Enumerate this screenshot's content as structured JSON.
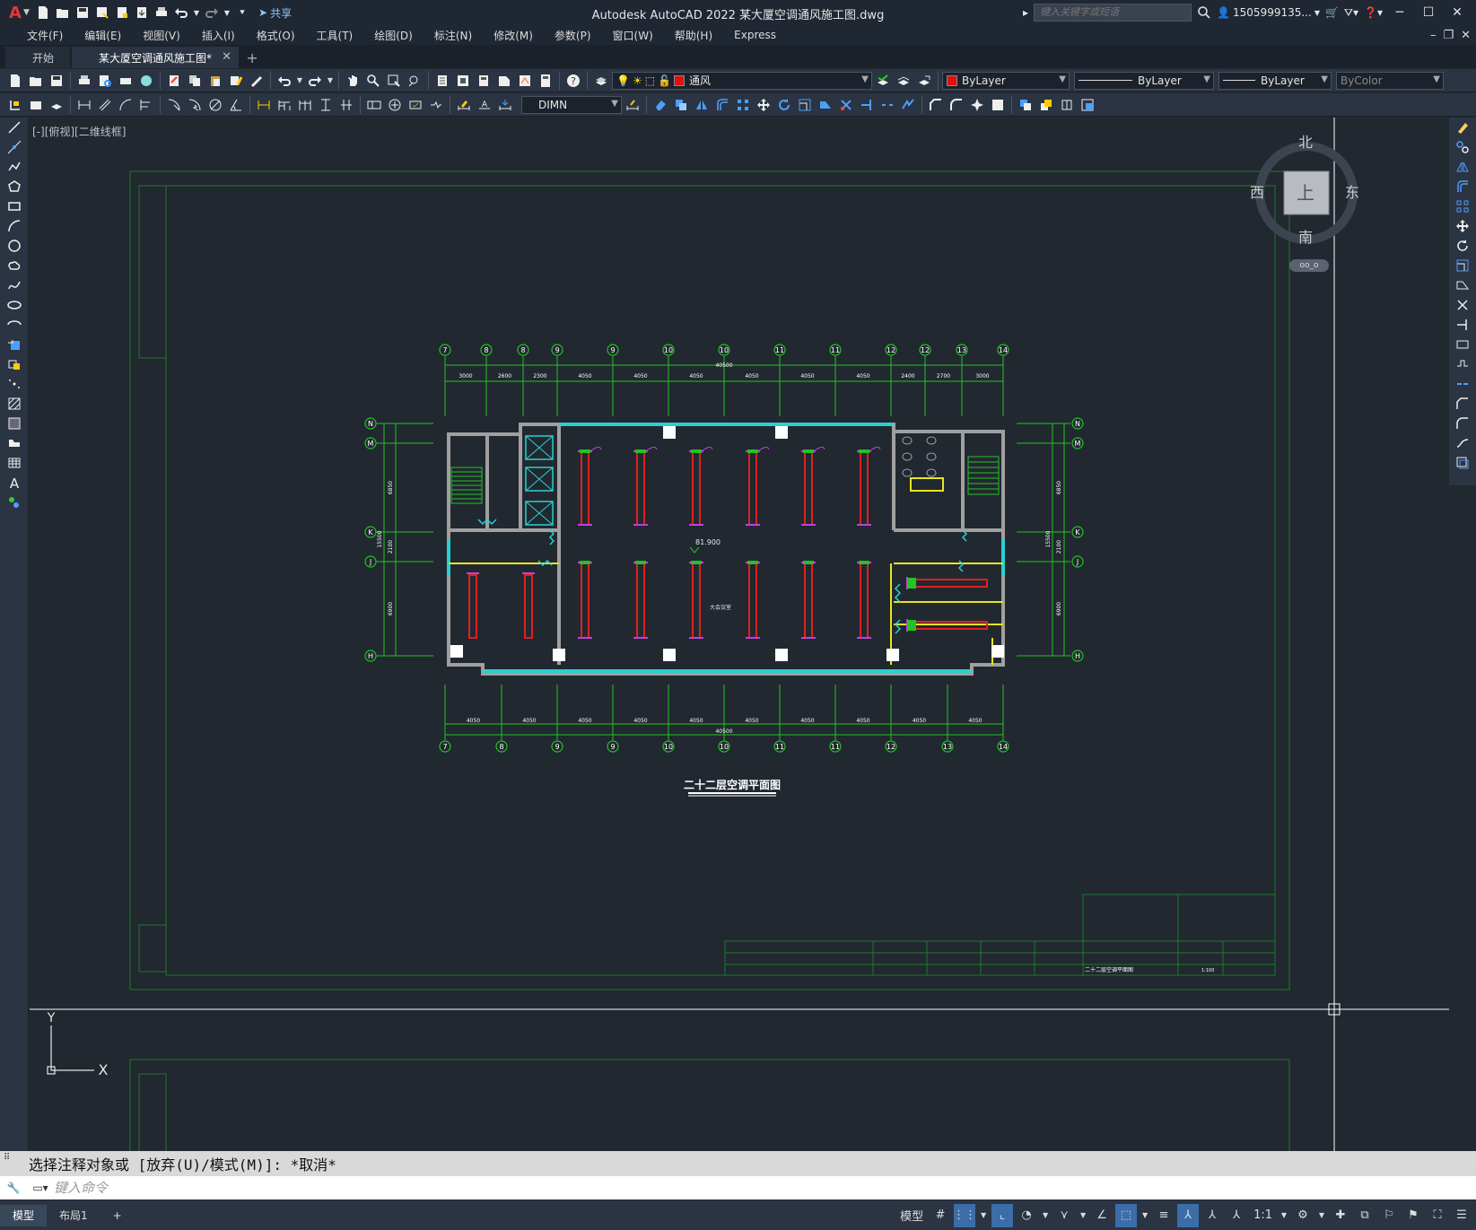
{
  "app": {
    "title": "Autodesk AutoCAD 2022    某大厦空调通风施工图.dwg",
    "share_label": "共享",
    "search_placeholder": "键入关键字或短语",
    "user": "1505999135...",
    "logo": "A"
  },
  "menu": [
    "文件(F)",
    "编辑(E)",
    "视图(V)",
    "插入(I)",
    "格式(O)",
    "工具(T)",
    "绘图(D)",
    "标注(N)",
    "修改(M)",
    "参数(P)",
    "窗口(W)",
    "帮助(H)",
    "Express"
  ],
  "tabs": {
    "start": "开始",
    "active": "某大厦空调通风施工图*",
    "add": "+"
  },
  "toolbar": {
    "layer": "通风",
    "color": "ByLayer",
    "linetype": "ByLayer",
    "lineweight": "ByLayer",
    "plotstyle": "ByColor",
    "dimstyle": "DIMN"
  },
  "viewport": {
    "label": "[-][俯视][二维线框]"
  },
  "viewcube": {
    "north": "北",
    "south": "南",
    "east": "东",
    "west": "西",
    "top": "上",
    "ucs": "oo_o"
  },
  "ucs": {
    "x": "X",
    "y": "Y"
  },
  "drawing": {
    "title": "二十二层空调平面图",
    "grid_top": [
      "7",
      "8",
      "8",
      "9",
      "9",
      "10",
      "10",
      "11",
      "11",
      "12",
      "12",
      "13",
      "14"
    ],
    "grid_bottom": [
      "7",
      "8",
      "9",
      "9",
      "10",
      "10",
      "11",
      "11",
      "12",
      "13",
      "14"
    ],
    "grid_rows": [
      "N",
      "M",
      "K",
      "J",
      "H"
    ],
    "dim_top": [
      "3000",
      "2600",
      "2300",
      "4050",
      "4050",
      "4050",
      "4050",
      "4050",
      "4050",
      "2400",
      "2700",
      "3000"
    ],
    "dim_top_total": "40500",
    "dim_bottom": [
      "4050",
      "4050",
      "4050",
      "4050",
      "4050",
      "4050",
      "4050",
      "4050",
      "4050",
      "4050"
    ],
    "dim_bottom_total": "40500",
    "dim_side": [
      "6850",
      "2100",
      "6900"
    ],
    "dim_side_total": "15500",
    "level": "81.900",
    "room_label": "大会议室",
    "titleblock_name": "二十二层空调平面图",
    "titleblock_scale": "1:100"
  },
  "command": {
    "history": "选择注释对象或 [放弃(U)/模式(M)]: *取消*",
    "placeholder": "键入命令"
  },
  "status": {
    "tab_model": "模型",
    "tab_layout": "布局1",
    "model_label": "模型",
    "scale": "1:1"
  },
  "colors": {
    "grid": "#22c322",
    "wall": "#a0a0a0",
    "window": "#2bd0d0",
    "duct_red": "#e02020",
    "duct_magenta": "#c040e0",
    "yellow": "#e6e620",
    "frame": "#1f7a2a"
  }
}
